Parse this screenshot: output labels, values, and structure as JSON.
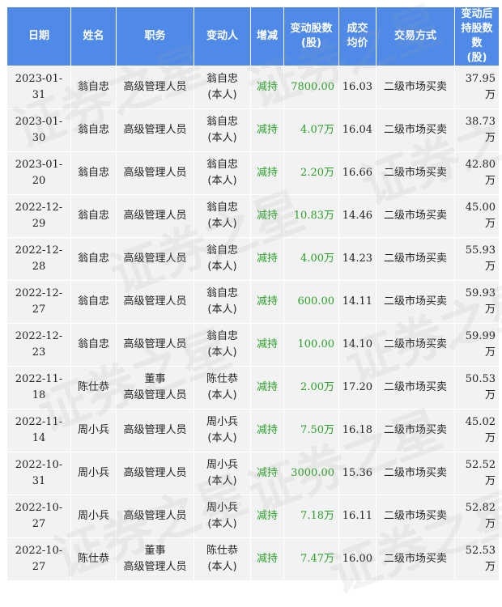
{
  "headers": {
    "date": "日期",
    "name": "姓名",
    "position": "职务",
    "changer": "变动人",
    "direction": "增减",
    "shares_line1": "变动股数",
    "shares_line2": "(股)",
    "price_line1": "成交",
    "price_line2": "均价",
    "method": "交易方式",
    "holding_line1": "变动后",
    "holding_line2": "持股数数",
    "holding_line3": "(股)"
  },
  "watermark": "证券之星",
  "colors": {
    "header_bg": "#4f8ae8",
    "row_bg": "#f2f2f2",
    "reduce_green": "#2aa02a"
  },
  "rows": [
    {
      "date": "2023-01-31",
      "name": "翁自忠",
      "position": [
        "高级管理人员"
      ],
      "changer": [
        "翁自忠",
        "(本人)"
      ],
      "direction": "减持",
      "shares": "7800.00",
      "price": "16.03",
      "method": "二级市场买卖",
      "holding": "37.95万"
    },
    {
      "date": "2023-01-30",
      "name": "翁自忠",
      "position": [
        "高级管理人员"
      ],
      "changer": [
        "翁自忠",
        "(本人)"
      ],
      "direction": "减持",
      "shares": "4.07万",
      "price": "16.04",
      "method": "二级市场买卖",
      "holding": "38.73万"
    },
    {
      "date": "2023-01-20",
      "name": "翁自忠",
      "position": [
        "高级管理人员"
      ],
      "changer": [
        "翁自忠",
        "(本人)"
      ],
      "direction": "减持",
      "shares": "2.20万",
      "price": "16.66",
      "method": "二级市场买卖",
      "holding": "42.80万"
    },
    {
      "date": "2022-12-29",
      "name": "翁自忠",
      "position": [
        "高级管理人员"
      ],
      "changer": [
        "翁自忠",
        "(本人)"
      ],
      "direction": "减持",
      "shares": "10.83万",
      "price": "14.46",
      "method": "二级市场买卖",
      "holding": "45.00万"
    },
    {
      "date": "2022-12-28",
      "name": "翁自忠",
      "position": [
        "高级管理人员"
      ],
      "changer": [
        "翁自忠",
        "(本人)"
      ],
      "direction": "减持",
      "shares": "4.00万",
      "price": "14.23",
      "method": "二级市场买卖",
      "holding": "55.93万"
    },
    {
      "date": "2022-12-27",
      "name": "翁自忠",
      "position": [
        "高级管理人员"
      ],
      "changer": [
        "翁自忠",
        "(本人)"
      ],
      "direction": "减持",
      "shares": "600.00",
      "price": "14.11",
      "method": "二级市场买卖",
      "holding": "59.93万"
    },
    {
      "date": "2022-12-23",
      "name": "翁自忠",
      "position": [
        "高级管理人员"
      ],
      "changer": [
        "翁自忠",
        "(本人)"
      ],
      "direction": "减持",
      "shares": "100.00",
      "price": "14.10",
      "method": "二级市场买卖",
      "holding": "59.99万"
    },
    {
      "date": "2022-11-18",
      "name": "陈仕恭",
      "position": [
        "董事",
        "高级管理人员"
      ],
      "changer": [
        "陈仕恭",
        "(本人)"
      ],
      "direction": "减持",
      "shares": "2.00万",
      "price": "17.20",
      "method": "二级市场买卖",
      "holding": "50.53万"
    },
    {
      "date": "2022-11-14",
      "name": "周小兵",
      "position": [
        "高级管理人员"
      ],
      "changer": [
        "周小兵",
        "(本人)"
      ],
      "direction": "减持",
      "shares": "7.50万",
      "price": "16.18",
      "method": "二级市场买卖",
      "holding": "45.02万"
    },
    {
      "date": "2022-10-31",
      "name": "周小兵",
      "position": [
        "高级管理人员"
      ],
      "changer": [
        "周小兵",
        "(本人)"
      ],
      "direction": "减持",
      "shares": "3000.00",
      "price": "15.36",
      "method": "二级市场买卖",
      "holding": "52.52万"
    },
    {
      "date": "2022-10-27",
      "name": "周小兵",
      "position": [
        "高级管理人员"
      ],
      "changer": [
        "周小兵",
        "(本人)"
      ],
      "direction": "减持",
      "shares": "7.18万",
      "price": "16.11",
      "method": "二级市场买卖",
      "holding": "52.82万"
    },
    {
      "date": "2022-10-27",
      "name": "陈仕恭",
      "position": [
        "董事",
        "高级管理人员"
      ],
      "changer": [
        "陈仕恭",
        "(本人)"
      ],
      "direction": "减持",
      "shares": "7.47万",
      "price": "16.00",
      "method": "二级市场买卖",
      "holding": "52.53万"
    }
  ]
}
